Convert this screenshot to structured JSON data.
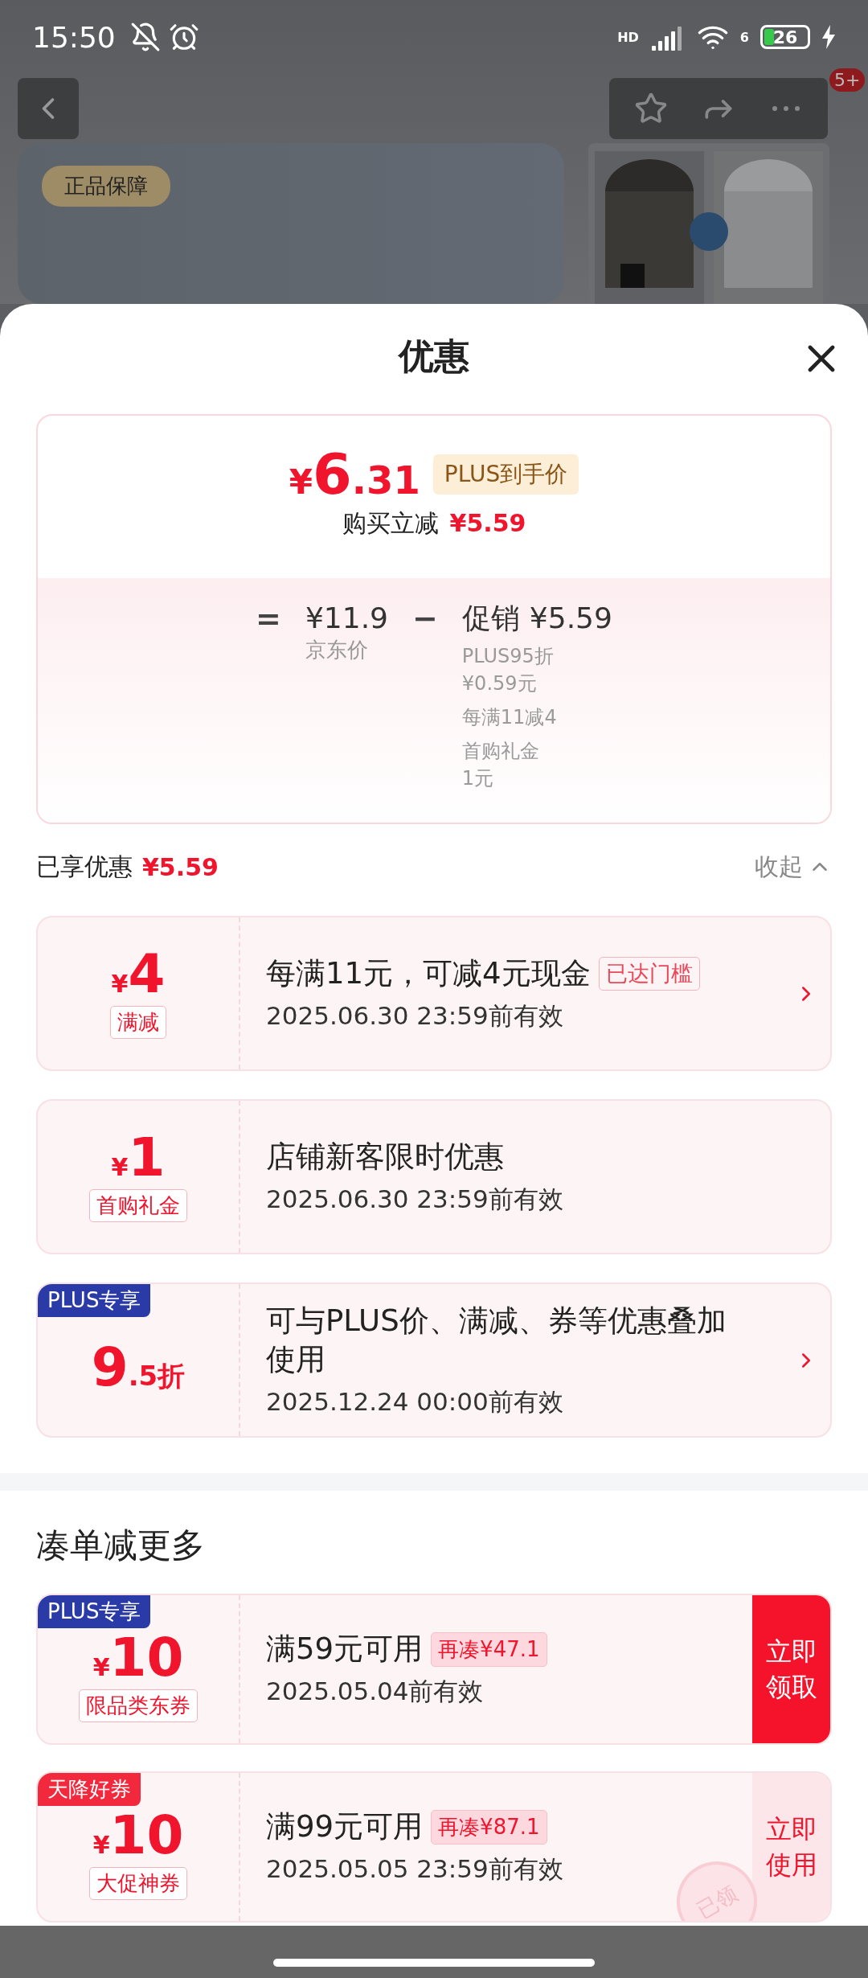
{
  "status_bar": {
    "time": "15:50",
    "network": "HD",
    "wifi_badge": "6",
    "battery": "26"
  },
  "background_page": {
    "badge": "正品保障",
    "menu_badge": "5+"
  },
  "sheet": {
    "title": "优惠"
  },
  "price_summary": {
    "currency": "¥",
    "integer": "6",
    "decimal": ".31",
    "badge": "PLUS到手价",
    "saving_label": "购买立减",
    "saving": "¥5.59",
    "equals": "=",
    "base_price": "¥11.9",
    "base_label": "京东价",
    "minus": "−",
    "promo_label": "促销",
    "promo_amount": "¥5.59",
    "promo_details": [
      "PLUS95折\n¥0.59元",
      "每满11减4",
      "首购礼金\n1元"
    ]
  },
  "enjoyed": {
    "label": "已享优惠",
    "amount": "¥5.59",
    "toggle": "收起"
  },
  "discounts": [
    {
      "currency": "¥",
      "amount": "4",
      "tag": "满减",
      "title": "每满11元，可减4元现金",
      "status": "已达门槛",
      "expiry": "2025.06.30 23:59前有效",
      "arrow": true
    },
    {
      "currency": "¥",
      "amount": "1",
      "tag": "首购礼金",
      "title": "店铺新客限时优惠",
      "expiry": "2025.06.30 23:59前有效",
      "arrow": false
    },
    {
      "corner": "PLUS专享",
      "color": "#2a3aa6",
      "amount": "9",
      "suffix": ".5折",
      "title": "可与PLUS价、满减、券等优惠叠加使用",
      "expiry": "2025.12.24 00:00前有效",
      "arrow": true
    }
  ],
  "more_section": {
    "title": "凑单减更多"
  },
  "coupons": [
    {
      "corner": "PLUS专享",
      "color": "#2a3aa6",
      "currency": "¥",
      "amount": "10",
      "tag": "限品类东券",
      "title": "满59元可用",
      "need": "再凑¥47.1",
      "expiry": "2025.05.04前有效",
      "action": {
        "label": "立即领取",
        "kind": "filled"
      }
    },
    {
      "corner": "天降好券",
      "color": "#f2283c",
      "currency": "¥",
      "amount": "10",
      "tag": "大促神券",
      "title": "满99元可用",
      "need": "再凑¥87.1",
      "expiry": "2025.05.05 23:59前有效",
      "stamp": "已领",
      "action": {
        "label": "立即使用",
        "kind": "soft"
      }
    }
  ]
}
